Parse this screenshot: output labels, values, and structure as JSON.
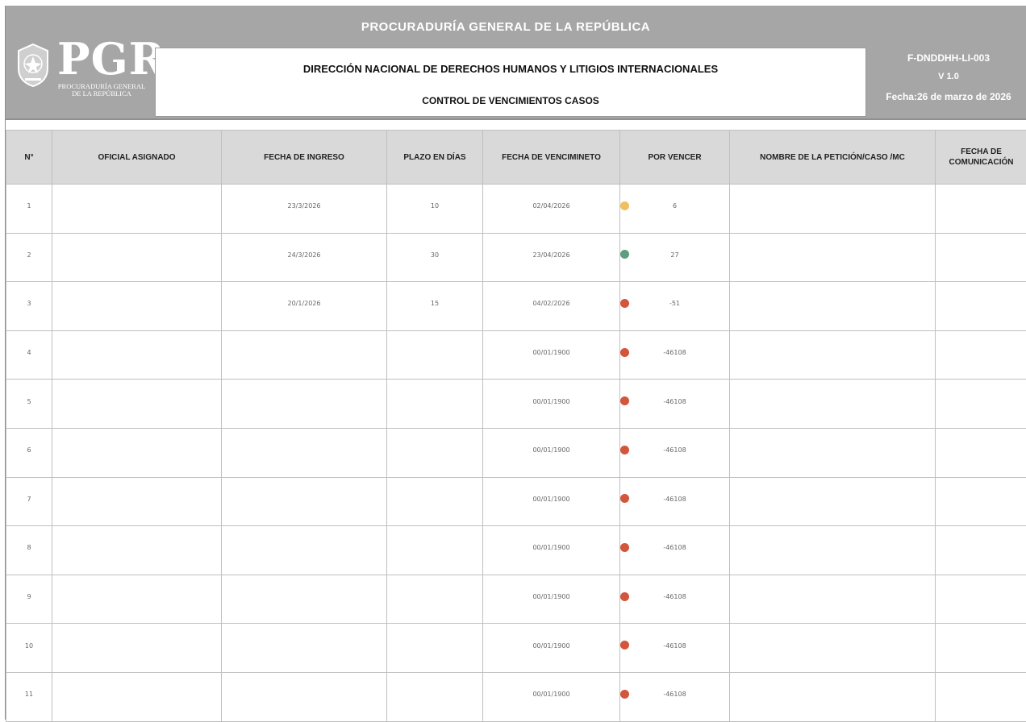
{
  "header": {
    "org_title": "PROCURADURÍA GENERAL DE LA REPÚBLICA",
    "logo_text": "PGR",
    "logo_subtitle_1": "PROCURADURÍA GENERAL",
    "logo_subtitle_2": "DE LA REPÚBLICA",
    "directorate": "DIRECCIÓN NACIONAL DE DERECHOS HUMANOS Y LITIGIOS INTERNACIONALES",
    "document_title": "CONTROL DE  VENCIMIENTOS CASOS",
    "form_code": "F-DNDDHH-LI-003",
    "version": "V 1.0",
    "date": "Fecha:26 de marzo de 2026"
  },
  "colors": {
    "header_bg": "#a6a6a6",
    "column_header_bg": "#d9d9d9",
    "status_yellow": "#f0c060",
    "status_green": "#5c9e7e",
    "status_red": "#d2553c",
    "negative_text": "#e05a4a"
  },
  "columns": [
    "N°",
    "OFICIAL ASIGNADO",
    "FECHA DE INGRESO",
    "PLAZO EN DÍAS",
    "FECHA DE VENCIMINETO",
    "POR VENCER",
    "NOMBRE DE LA PETICIÓN/CASO /MC",
    "FECHA DE COMUNICACIÓN"
  ],
  "rows": [
    {
      "n": "1",
      "officer": "",
      "intake": "23/3/2026",
      "days": "10",
      "due": "02/04/2026",
      "remaining": "6",
      "status": "yellow",
      "name": "",
      "comm": ""
    },
    {
      "n": "2",
      "officer": "",
      "intake": "24/3/2026",
      "days": "30",
      "due": "23/04/2026",
      "remaining": "27",
      "status": "green",
      "name": "",
      "comm": ""
    },
    {
      "n": "3",
      "officer": "",
      "intake": "20/1/2026",
      "days": "15",
      "due": "04/02/2026",
      "remaining": "-51",
      "status": "red",
      "name": "",
      "comm": ""
    },
    {
      "n": "4",
      "officer": "",
      "intake": "",
      "days": "",
      "due": "00/01/1900",
      "remaining": "-46108",
      "status": "red",
      "name": "",
      "comm": ""
    },
    {
      "n": "5",
      "officer": "",
      "intake": "",
      "days": "",
      "due": "00/01/1900",
      "remaining": "-46108",
      "status": "red",
      "name": "",
      "comm": ""
    },
    {
      "n": "6",
      "officer": "",
      "intake": "",
      "days": "",
      "due": "00/01/1900",
      "remaining": "-46108",
      "status": "red",
      "name": "",
      "comm": ""
    },
    {
      "n": "7",
      "officer": "",
      "intake": "",
      "days": "",
      "due": "00/01/1900",
      "remaining": "-46108",
      "status": "red",
      "name": "",
      "comm": ""
    },
    {
      "n": "8",
      "officer": "",
      "intake": "",
      "days": "",
      "due": "00/01/1900",
      "remaining": "-46108",
      "status": "red",
      "name": "",
      "comm": ""
    },
    {
      "n": "9",
      "officer": "",
      "intake": "",
      "days": "",
      "due": "00/01/1900",
      "remaining": "-46108",
      "status": "red",
      "name": "",
      "comm": ""
    },
    {
      "n": "10",
      "officer": "",
      "intake": "",
      "days": "",
      "due": "00/01/1900",
      "remaining": "-46108",
      "status": "red",
      "name": "",
      "comm": ""
    },
    {
      "n": "11",
      "officer": "",
      "intake": "",
      "days": "",
      "due": "00/01/1900",
      "remaining": "-46108",
      "status": "red",
      "name": "",
      "comm": ""
    }
  ]
}
